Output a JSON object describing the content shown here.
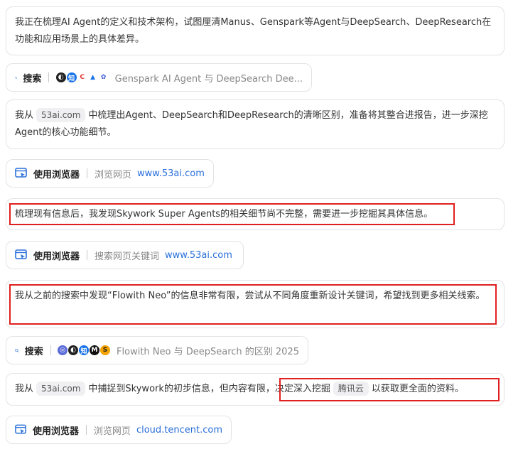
{
  "steps": {
    "t1": "我正在梳理AI Agent的定义和技术架构，试图厘清Manus、Genspark等Agent与DeepSearch、DeepResearch在功能和应用场景上的具体差异。",
    "search1": {
      "label": "搜索",
      "query": "Genspark AI Agent 与 DeepSearch Dee..."
    },
    "t2a": "我从",
    "t2_source": "53ai.com",
    "t2b": "中梳理出Agent、DeepSearch和DeepResearch的清晰区别，准备将其整合进报告，进一步深挖Agent的核心功能细节。",
    "browse1": {
      "label": "使用浏览器",
      "action": "浏览网页",
      "url": "www.53ai.com"
    },
    "t3": "梳理现有信息后，我发现Skywork Super Agents的相关细节尚不完整，需要进一步挖掘其具体信息。",
    "browse2": {
      "label": "使用浏览器",
      "action": "搜索网页关键词",
      "url": "www.53ai.com"
    },
    "t4": "我从之前的搜索中发现“Flowith Neo”的信息非常有限，尝试从不同角度重新设计关键词，希望找到更多相关线索。",
    "search2": {
      "label": "搜索",
      "query": "Flowith Neo 与 DeepSearch 的区别 2025"
    },
    "t5a": "我从",
    "t5_source": "53ai.com",
    "t5b": "中捕捉到Skywork的初步信息，但内容有限，决定深入挖掘",
    "t5_source2": "腾讯云",
    "t5c": "以获取更全面的资料。",
    "browse3": {
      "label": "使用浏览器",
      "action": "浏览网页",
      "url": "cloud.tencent.com"
    }
  },
  "colors": {
    "highlight": "#e02020",
    "link": "#2a6fdb",
    "icon": "#2a6fdb"
  }
}
